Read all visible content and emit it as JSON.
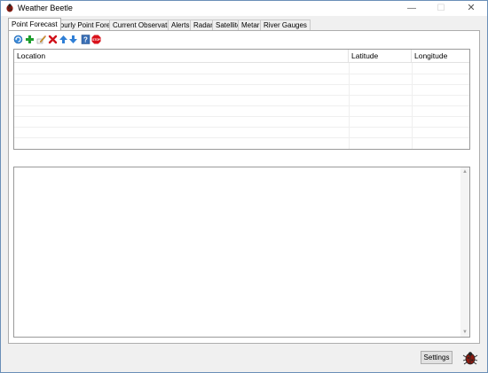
{
  "window": {
    "title": "Weather Beetle",
    "minimize_glyph": "—",
    "maximize_glyph": "☐",
    "close_glyph": "✕"
  },
  "tabs": [
    {
      "label": "Point Forecast",
      "active": true
    },
    {
      "label": "Hourly Point Forecast",
      "active": false
    },
    {
      "label": "Current Observations",
      "active": false
    },
    {
      "label": "Alerts",
      "active": false
    },
    {
      "label": "Radar",
      "active": false
    },
    {
      "label": "Satellite",
      "active": false
    },
    {
      "label": "Metar",
      "active": false
    },
    {
      "label": "River Gauges",
      "active": false
    }
  ],
  "toolbar": {
    "icons": [
      "refresh-icon",
      "add-icon",
      "edit-icon",
      "delete-icon",
      "move-up-icon",
      "move-down-icon",
      "help-icon",
      "stop-icon"
    ],
    "stop_text": "STOP",
    "help_text": "?"
  },
  "locations_table": {
    "columns": [
      "Location",
      "Latitude",
      "Longitude"
    ],
    "rows": []
  },
  "forecast_text": {
    "value": ""
  },
  "footer": {
    "settings_label": "Settings"
  },
  "colors": {
    "window_border": "#6a8fb8",
    "background": "#f0f0f0",
    "add_green": "#1e9e2e",
    "delete_red": "#d0121b",
    "arrow_blue": "#2f7fd6",
    "stop_red": "#d9121b"
  }
}
